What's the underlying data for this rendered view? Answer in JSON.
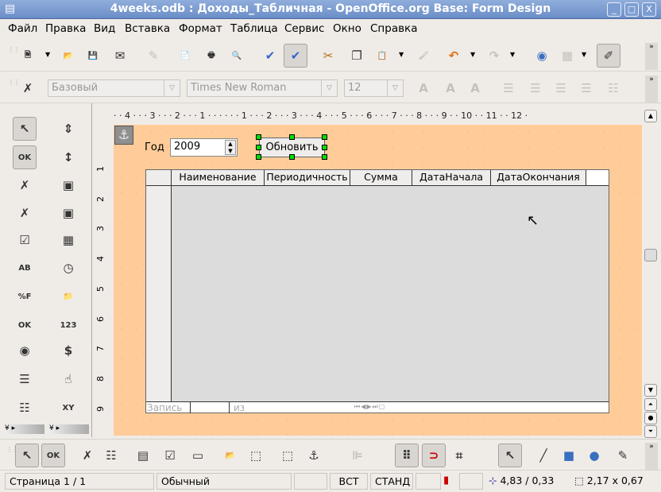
{
  "window": {
    "title": "4weeks.odb : Доходы_Табличная - OpenOffice.org Base: Form Design",
    "minimize": "_",
    "maximize": "□",
    "close": "X"
  },
  "menu": [
    "Файл",
    "Правка",
    "Вид",
    "Вставка",
    "Формат",
    "Таблица",
    "Сервис",
    "Окно",
    "Справка"
  ],
  "standard_toolbar": [
    "new-document-icon",
    "open-folder-icon",
    "save-icon",
    "email-icon",
    "edit-file-icon",
    "export-pdf-icon",
    "print-icon",
    "page-preview-icon",
    "spellcheck-icon",
    "autospellcheck-icon",
    "cut-icon",
    "copy-icon",
    "paste-icon",
    "format-paintbrush-icon",
    "undo-icon",
    "redo-icon",
    "navigator-icon",
    "table-icon",
    "design-mode-icon"
  ],
  "format_toolbar": {
    "style": "Базовый",
    "font": "Times New Roman",
    "size": "12",
    "icons": [
      "bold-icon",
      "italic-icon",
      "underline-icon",
      "align-left-icon",
      "align-center-icon",
      "align-right-icon",
      "justify-icon",
      "numbering-icon"
    ]
  },
  "toolbox": [
    "select-icon",
    "spin-button-icon",
    "push-button-icon",
    "scrollbar-icon",
    "form-design-icon",
    "image-button-icon",
    "control-properties-icon",
    "image-control-icon",
    "checkbox-icon",
    "table-control-icon",
    "text-box-icon",
    "time-field-icon",
    "formatted-field-icon",
    "file-selection-icon",
    "button-ok-icon",
    "numeric-field-icon",
    "option-button-icon",
    "currency-field-icon",
    "list-box-icon",
    "pattern-field-icon",
    "combo-box-icon",
    "group-box-icon"
  ],
  "ruler": {
    "h": "· · 4 · · · 3 · · · 2 · · · 1 · · ·   · · · 1 · · · 2 · · · 3 · · · 4 · · · 5 · · · 6 · · · 7 · · · 8 · · · 9 · · 10 · · 11 · · 12 ·",
    "v": [
      "1",
      "2",
      "3",
      "4",
      "5",
      "6",
      "7",
      "8",
      "9"
    ]
  },
  "form": {
    "year_label": "Год",
    "year_value": "2009",
    "refresh_button": "Обновить",
    "columns": [
      "Наименование",
      "Периодичность",
      "Сумма",
      "ДатаНачала",
      "ДатаОкончания"
    ],
    "nav": {
      "record_label": "Запись",
      "of_label": "из"
    }
  },
  "form_design_toolbar": [
    "select-icon",
    "push-button-icon",
    "control-properties-icon",
    "form-properties-icon",
    "form-navigator-icon",
    "add-field-icon",
    "activation-order-icon",
    "open-design-mode-icon",
    "automatic-control-focus-icon",
    "position-size-icon",
    "anchor-icon",
    "align-icon",
    "grid-icon",
    "snap-to-grid-icon",
    "helplines-icon",
    "select-icon",
    "line-icon",
    "rectangle-icon",
    "ellipse-icon",
    "freeform-icon"
  ],
  "status": {
    "page": "Страница  1 / 1",
    "style": "Обычный",
    "insert": "ВСТ",
    "mode": "СТАНД",
    "position": "4,83 / 0,33",
    "size": "2,17 x 0,67"
  },
  "colors": {
    "form_bg": "#ffcc99",
    "selection_handles": "#00e000",
    "titlebar": "#7d9dd2"
  }
}
